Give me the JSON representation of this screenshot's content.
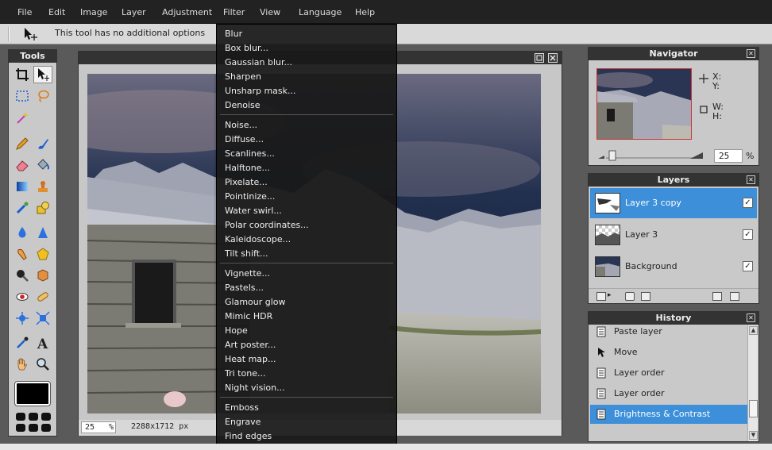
{
  "menubar": {
    "items": [
      "File",
      "Edit",
      "Image",
      "Layer",
      "Adjustment",
      "Filter",
      "View",
      "Language",
      "Help"
    ]
  },
  "options_bar": {
    "message": "This tool has no additional options"
  },
  "tools_panel": {
    "title": "Tools",
    "tools": [
      "crop-icon",
      "move-icon",
      "marquee-icon",
      "lasso-icon",
      "magic-wand-icon",
      "pencil-icon",
      "brush-icon",
      "eraser-icon",
      "fill-icon",
      "gradient-icon",
      "stamp-icon",
      "colorreplace-icon",
      "shape-icon",
      "blur-icon",
      "sharpen-icon",
      "smudge-icon",
      "sponge-icon",
      "dodge-icon",
      "burn-icon",
      "redeye-icon",
      "spotheal-icon",
      "bloat-icon",
      "pinch-icon",
      "picker-icon",
      "type-icon",
      "hand-icon",
      "zoom-icon"
    ],
    "fg_color": "#000000"
  },
  "canvas": {
    "zoom": "25",
    "zoom_unit": "%",
    "dimensions": "2288x1712 px"
  },
  "filter_menu": {
    "groups": [
      [
        "Blur",
        "Box blur...",
        "Gaussian blur...",
        "Sharpen",
        "Unsharp mask...",
        "Denoise"
      ],
      [
        "Noise...",
        "Diffuse...",
        "Scanlines...",
        "Halftone...",
        "Pixelate...",
        "Pointinize...",
        "Water swirl...",
        "Polar coordinates...",
        "Kaleidoscope...",
        "Tilt shift..."
      ],
      [
        "Vignette...",
        "Pastels...",
        "Glamour glow",
        "Mimic HDR",
        "Hope",
        "Art poster...",
        "Heat map...",
        "Tri tone...",
        "Night vision..."
      ],
      [
        "Emboss",
        "Engrave",
        "Find edges"
      ]
    ]
  },
  "navigator": {
    "title": "Navigator",
    "x_label": "X:",
    "y_label": "Y:",
    "w_label": "W:",
    "h_label": "H:",
    "zoom": "25",
    "zoom_unit": "%"
  },
  "layers": {
    "title": "Layers",
    "items": [
      {
        "name": "Layer 3 copy",
        "selected": true,
        "visible": true
      },
      {
        "name": "Layer 3",
        "selected": false,
        "visible": true
      },
      {
        "name": "Background",
        "selected": false,
        "visible": true
      }
    ]
  },
  "history": {
    "title": "History",
    "items": [
      {
        "name": "Paste layer",
        "selected": false
      },
      {
        "name": "Move",
        "selected": false
      },
      {
        "name": "Layer order",
        "selected": false
      },
      {
        "name": "Layer order",
        "selected": false
      },
      {
        "name": "Brightness & Contrast",
        "selected": true
      }
    ]
  },
  "colors": {
    "accent": "#3c8fd8",
    "panel_bg": "#c9c9c9",
    "titlebar": "#333333",
    "menubar": "#222222"
  }
}
